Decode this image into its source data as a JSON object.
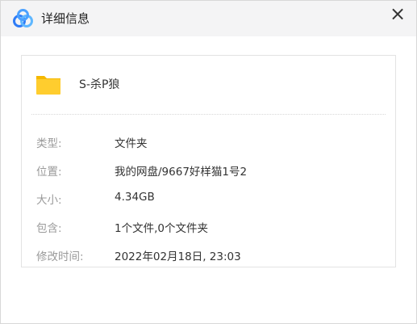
{
  "window": {
    "title": "详细信息",
    "logo_icon": "baidu-netdisk-logo-icon",
    "close_glyph": "×"
  },
  "file": {
    "icon": "folder-icon",
    "name": "S-杀P狼"
  },
  "details": [
    {
      "label": "类型:",
      "value": "文件夹"
    },
    {
      "label": "位置:",
      "value": "我的网盘/9667好样猫1号2"
    },
    {
      "label": "大小:",
      "value": "4.34GB"
    },
    {
      "label": "包含:",
      "value": "1个文件,0个文件夹"
    },
    {
      "label": "修改时间:",
      "value": "2022年02月18日, 23:03"
    }
  ],
  "colors": {
    "titlebar_bg": "#f4f4f5",
    "logo_blue": "#2f7cf6",
    "logo_light_blue": "#5fb7ff",
    "folder_yellow": "#ffcd2e",
    "label_gray": "#9a9a9a"
  }
}
